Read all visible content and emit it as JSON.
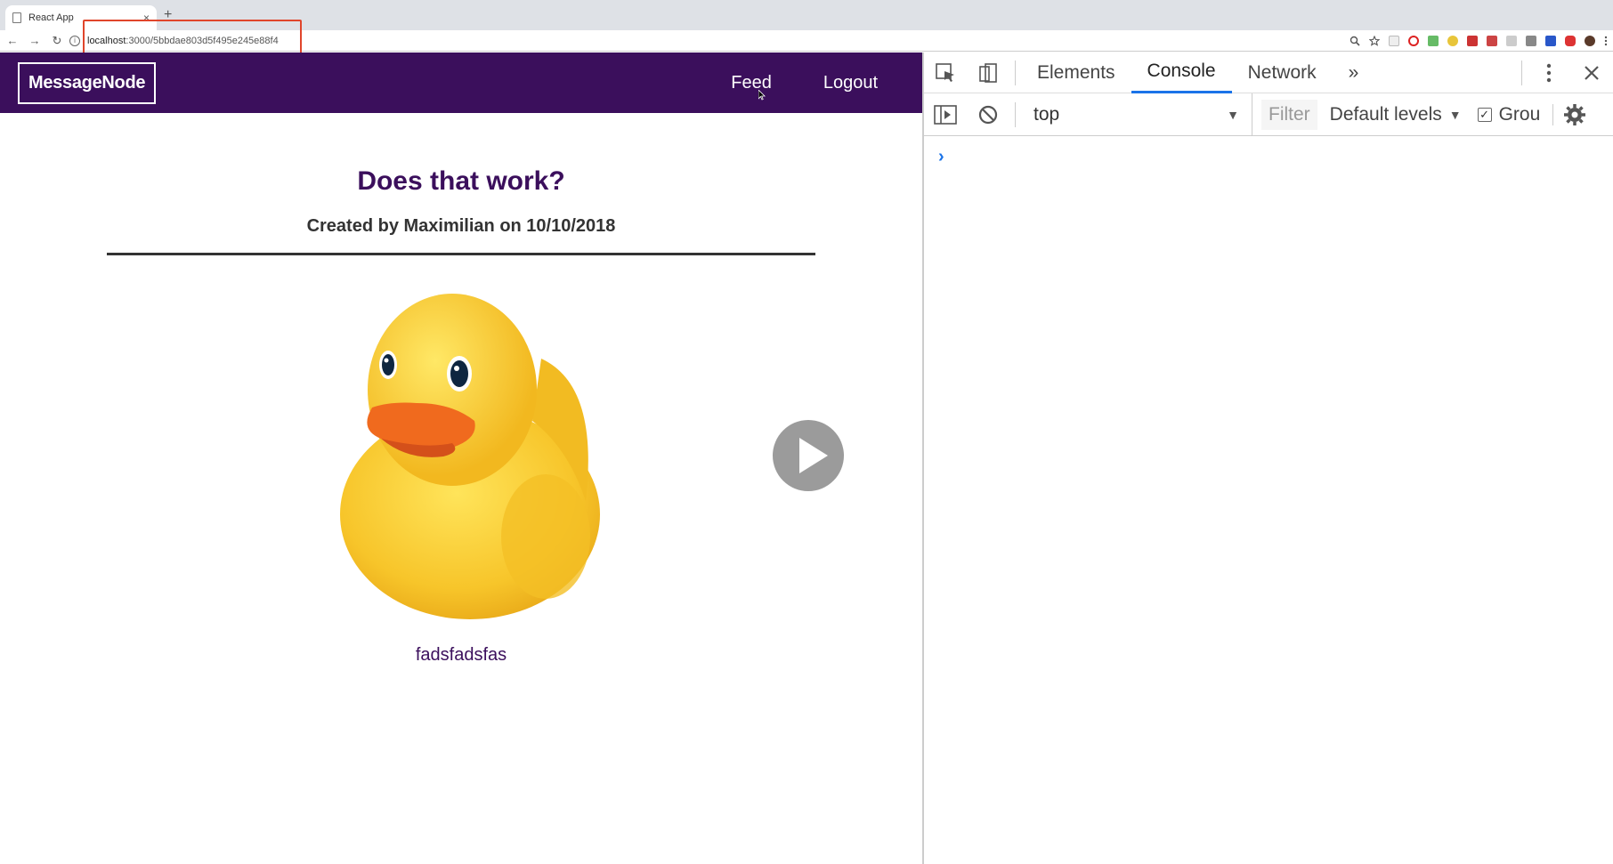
{
  "browser": {
    "tab_title": "React App",
    "tab_close": "×",
    "new_tab": "+",
    "nav_back": "←",
    "nav_forward": "→",
    "nav_reload": "↻",
    "url_host": "localhost",
    "url_path": ":3000/5bbdae803d5f495e245e88f4",
    "extension_icons": [
      "zoom-icon",
      "star-icon",
      "extension-icon",
      "opera-icon",
      "extension-icon",
      "extension-icon",
      "extension-icon",
      "extension-icon",
      "extension-icon",
      "extension-icon",
      "abp-icon",
      "avatar",
      "menu-icon"
    ]
  },
  "app": {
    "logo": "MessageNode",
    "nav": {
      "feed": "Feed",
      "logout": "Logout"
    },
    "post": {
      "title": "Does that work?",
      "meta": "Created by Maximilian on 10/10/2018",
      "image_alt": "rubber duck",
      "content": "fadsfadsfas"
    }
  },
  "devtools": {
    "tabs": {
      "elements": "Elements",
      "console": "Console",
      "network": "Network"
    },
    "more_tabs": "»",
    "context": "top",
    "filter_placeholder": "Filter",
    "levels": "Default levels",
    "group_label": "Grou",
    "prompt": "›"
  },
  "colors": {
    "header_bg": "#3b0f5c",
    "title_color": "#3b0f5c",
    "devtools_accent": "#1a73e8",
    "url_highlight": "#e0452b"
  }
}
